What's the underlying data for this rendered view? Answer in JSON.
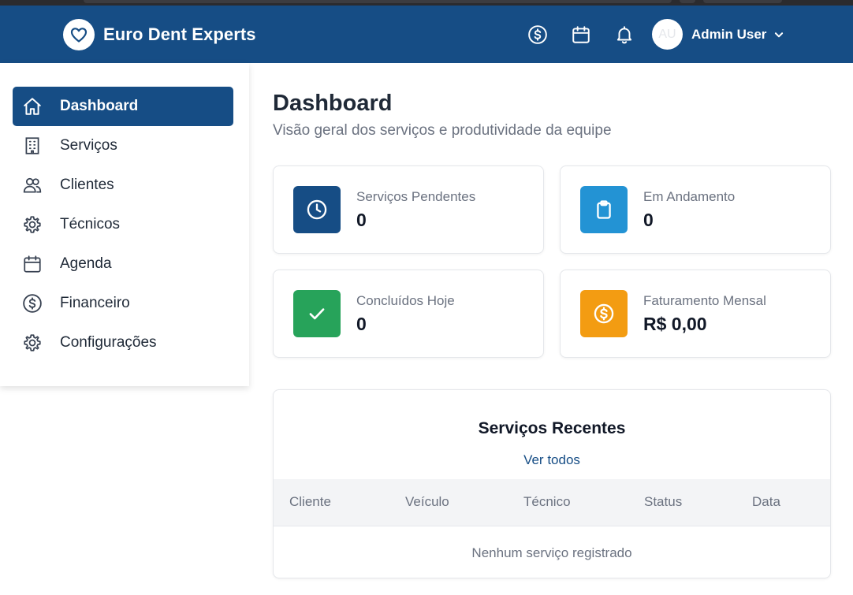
{
  "app": {
    "name": "Euro Dent Experts"
  },
  "header": {
    "icons": [
      "dollar-circle-icon",
      "calendar-icon",
      "bell-icon"
    ],
    "user": {
      "initials": "AU",
      "name": "Admin User"
    }
  },
  "sidebar": {
    "items": [
      {
        "label": "Dashboard",
        "icon": "home-icon",
        "active": true
      },
      {
        "label": "Serviços",
        "icon": "building-icon",
        "active": false
      },
      {
        "label": "Clientes",
        "icon": "users-icon",
        "active": false
      },
      {
        "label": "Técnicos",
        "icon": "gear-icon",
        "active": false
      },
      {
        "label": "Agenda",
        "icon": "calendar-icon",
        "active": false
      },
      {
        "label": "Financeiro",
        "icon": "dollar-circle-icon",
        "active": false
      },
      {
        "label": "Configurações",
        "icon": "gear-icon",
        "active": false
      }
    ]
  },
  "main": {
    "title": "Dashboard",
    "subtitle": "Visão geral dos serviços e produtividade da equipe",
    "stats": [
      {
        "label": "Serviços Pendentes",
        "value": "0",
        "icon": "clock-icon",
        "color": "#164d85"
      },
      {
        "label": "Em Andamento",
        "value": "0",
        "icon": "clipboard-icon",
        "color": "#2393d4"
      },
      {
        "label": "Concluídos Hoje",
        "value": "0",
        "icon": "check-icon",
        "color": "#27a35a"
      },
      {
        "label": "Faturamento Mensal",
        "value": "R$ 0,00",
        "icon": "dollar-circle-icon",
        "color": "#f39c12"
      }
    ],
    "recent": {
      "title": "Serviços Recentes",
      "link": "Ver todos",
      "columns": [
        "Cliente",
        "Veículo",
        "Técnico",
        "Status",
        "Data"
      ],
      "empty_text": "Nenhum serviço registrado"
    }
  },
  "colors": {
    "primary": "#164d85",
    "background": "#ffffff",
    "muted_text": "#6b7280"
  }
}
